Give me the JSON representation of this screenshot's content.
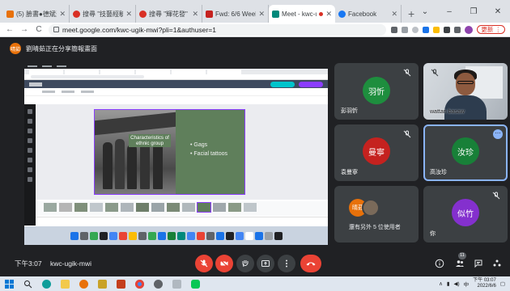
{
  "browser": {
    "tabs": [
      {
        "title": "(5) 臉書●德斌素材",
        "favicon_color": "#e8710a"
      },
      {
        "title": "搜尋 \"技藝經驗談\"",
        "favicon_color": "#d93025"
      },
      {
        "title": "搜尋 \"輝花發\" - Pl",
        "favicon_color": "#d93025"
      },
      {
        "title": "Fwd: 6/6 Week 1",
        "favicon_color": "#c5221f"
      },
      {
        "title": "Meet - kwc-u",
        "favicon_color": "#00897b",
        "active": true
      },
      {
        "title": "Facebook",
        "favicon_color": "#1877f2"
      }
    ],
    "new_tab": "+",
    "window_controls": [
      "⌄",
      "–",
      "❐",
      "✕"
    ],
    "back": "←",
    "forward": "→",
    "reload": "C",
    "url": "meet.google.com/kwc-ugik-mwi?pli=1&authuser=1",
    "update_label": "更新 ⋮"
  },
  "meet": {
    "banner_text": "劉晴茹正在分享簡報畫面",
    "presenter_initials": "晴茹",
    "slide": {
      "title": "Characteristics of ethnic group",
      "bullets": [
        "Gags",
        "Facial tattoos"
      ]
    },
    "participants": [
      {
        "avatar": "羽忻",
        "name": "彭羽忻",
        "color": "#1e8e3e"
      },
      {
        "avatar": "",
        "name": "wattan basaw",
        "color": "",
        "video": true
      },
      {
        "avatar": "曼寧",
        "name": "袁曼寧",
        "color": "#c5221f"
      },
      {
        "avatar": "汝珍",
        "name": "高汝珍",
        "color": "#188038",
        "speaking": true
      },
      {
        "avatar": "似竹",
        "name": "你",
        "color": "#8430ce"
      }
    ],
    "others": {
      "avatar": "晴茹",
      "label": "還有另外 5 位使用者"
    },
    "time": "下午3:07",
    "meeting_code": "kwc-ugik-mwi",
    "participant_count": "11"
  },
  "taskbar": {
    "clock_time": "下午 03:07",
    "clock_date": "2022/6/6",
    "lang": "中"
  }
}
